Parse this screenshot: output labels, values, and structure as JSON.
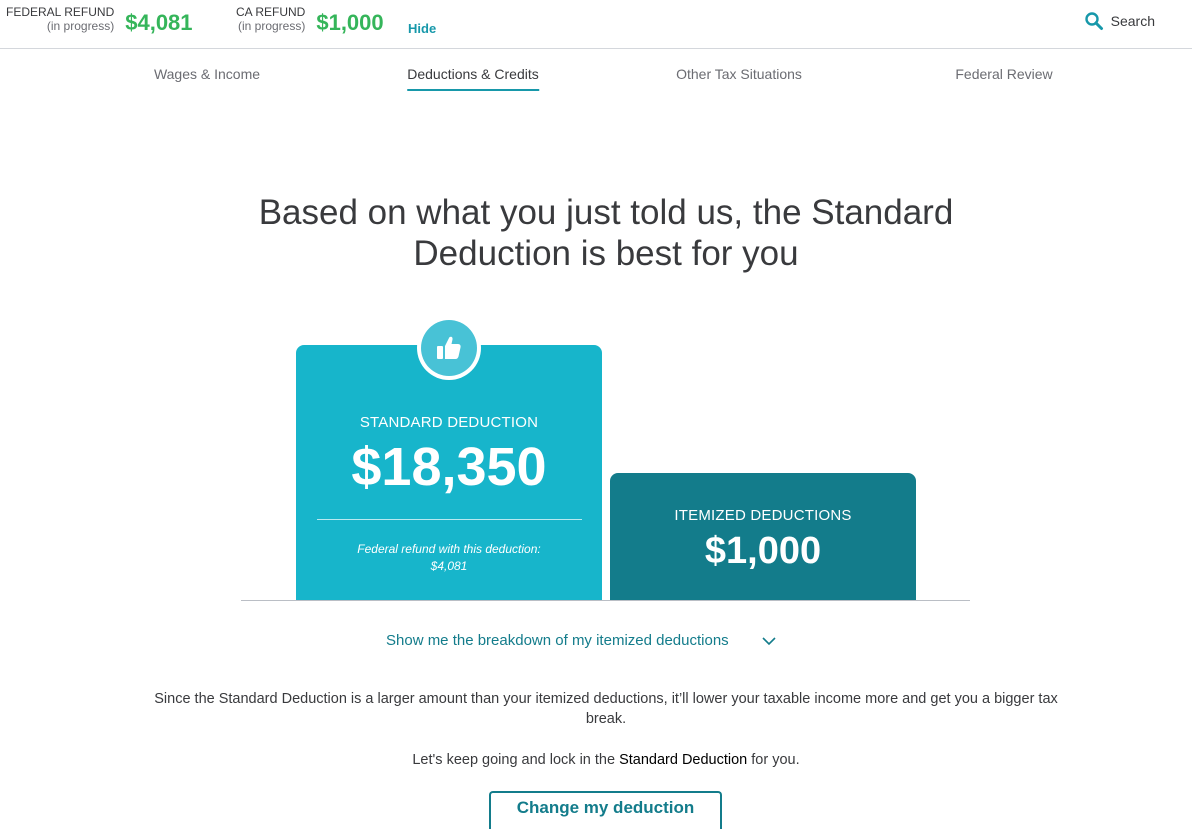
{
  "refund_bar": {
    "federal": {
      "label": "FEDERAL REFUND",
      "sublabel": "(in progress)",
      "amount": "$4,081"
    },
    "state": {
      "label": "CA REFUND",
      "sublabel": "(in progress)",
      "amount": "$1,000"
    },
    "hide_label": "Hide",
    "search_label": "Search",
    "amount_color": "#35b55a"
  },
  "tabs": [
    {
      "label": "Wages & Income",
      "active": false
    },
    {
      "label": "Deductions & Credits",
      "active": true
    },
    {
      "label": "Other Tax Situations",
      "active": false
    },
    {
      "label": "Federal Review",
      "active": false
    }
  ],
  "headline": "Based on what you just told us, the Standard Deduction is best for you",
  "standard_card": {
    "icon": "thumbs-up-icon",
    "label": "STANDARD DEDUCTION",
    "amount": "$18,350",
    "note_line1": "Federal refund with this deduction:",
    "note_line2": "$4,081",
    "color": "#17b5cb"
  },
  "itemized_card": {
    "label": "ITEMIZED DEDUCTIONS",
    "amount": "$1,000",
    "color": "#137c8b"
  },
  "breakdown_link": {
    "label": "Show me the breakdown of my itemized deductions",
    "icon": "chevron-down-icon"
  },
  "explanation": "Since the Standard Deduction is a larger amount than your itemized deductions, it’ll lower your taxable income more and get you a bigger tax break.",
  "lockin": {
    "prefix": "Let's keep going and lock in the ",
    "emphasis": "Standard Deduction",
    "suffix": " for you."
  },
  "change_button_label": "Change my deduction",
  "accent_color": "#1798aa"
}
